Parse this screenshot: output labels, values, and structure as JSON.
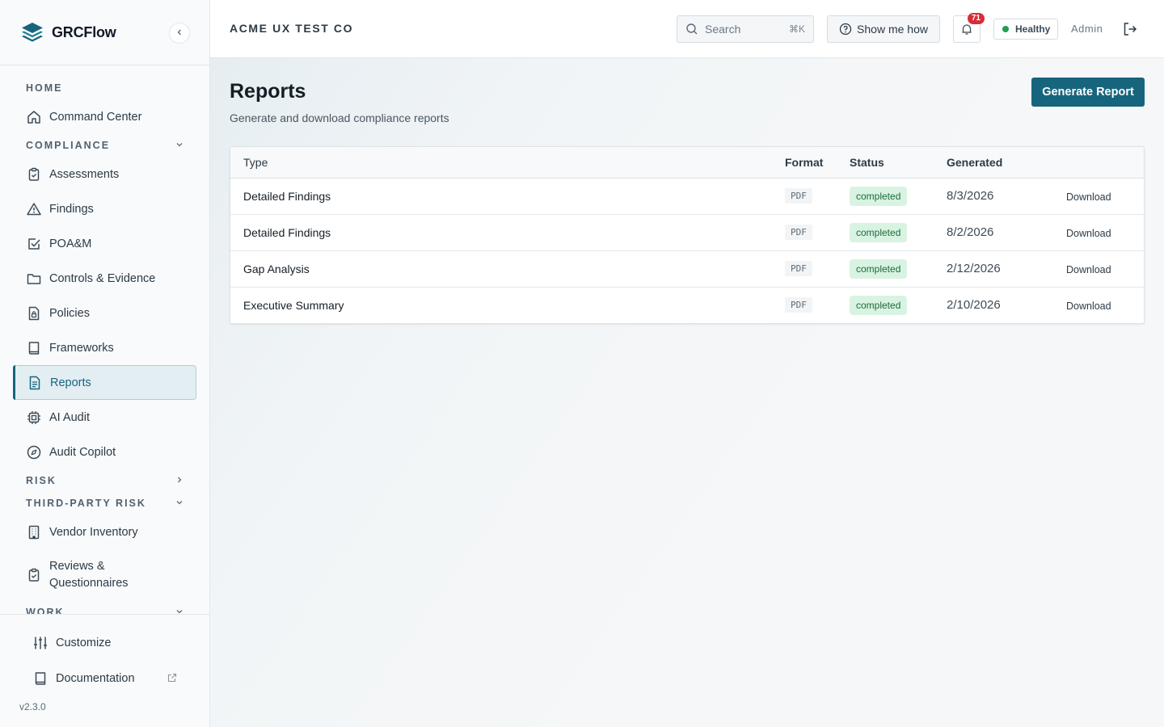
{
  "brand": {
    "name": "GRCFlow"
  },
  "topbar": {
    "org_name": "ACME UX TEST CO",
    "search_label": "Search",
    "search_shortcut": "⌘K",
    "show_me_how": "Show me how",
    "notification_count": "71",
    "health_status": "Healthy",
    "user_role": "Admin"
  },
  "sidebar": {
    "sections": {
      "home": "HOME",
      "compliance": "COMPLIANCE",
      "risk": "RISK",
      "third_party": "THIRD-PARTY RISK",
      "work": "WORK"
    },
    "items": {
      "command_center": "Command Center",
      "assessments": "Assessments",
      "findings": "Findings",
      "poam": "POA&M",
      "controls": "Controls & Evidence",
      "policies": "Policies",
      "frameworks": "Frameworks",
      "reports": "Reports",
      "ai_audit": "AI Audit",
      "audit_copilot": "Audit Copilot",
      "vendor_inventory": "Vendor Inventory",
      "reviews_line1": "Reviews &",
      "reviews_line2": "Questionnaires"
    },
    "footer": {
      "customize": "Customize",
      "documentation": "Documentation",
      "version": "v2.3.0"
    },
    "active_item": "reports"
  },
  "main": {
    "title": "Reports",
    "subtitle": "Generate and download compliance reports",
    "generate_button": "Generate Report",
    "table": {
      "headers": {
        "type": "Type",
        "format": "Format",
        "status": "Status",
        "generated": "Generated"
      },
      "rows": [
        {
          "type": "Detailed Findings",
          "format": "PDF",
          "status": "completed",
          "generated": "8/3/2026",
          "action": "Download"
        },
        {
          "type": "Detailed Findings",
          "format": "PDF",
          "status": "completed",
          "generated": "8/2/2026",
          "action": "Download"
        },
        {
          "type": "Gap Analysis",
          "format": "PDF",
          "status": "completed",
          "generated": "2/12/2026",
          "action": "Download"
        },
        {
          "type": "Executive Summary",
          "format": "PDF",
          "status": "completed",
          "generated": "2/10/2026",
          "action": "Download"
        }
      ]
    }
  },
  "colors": {
    "accent": "#17657d",
    "status_completed_bg": "#d9f3e2",
    "status_completed_text": "#1c6b3a",
    "badge_red": "#d92d3a",
    "health_green": "#1f9d55"
  },
  "icons": {
    "brand": "layers-icon",
    "collapse": "chevron-left-icon",
    "search": "search-icon",
    "help": "question-circle-icon",
    "notifications": "bell-icon",
    "logout": "logout-icon"
  }
}
